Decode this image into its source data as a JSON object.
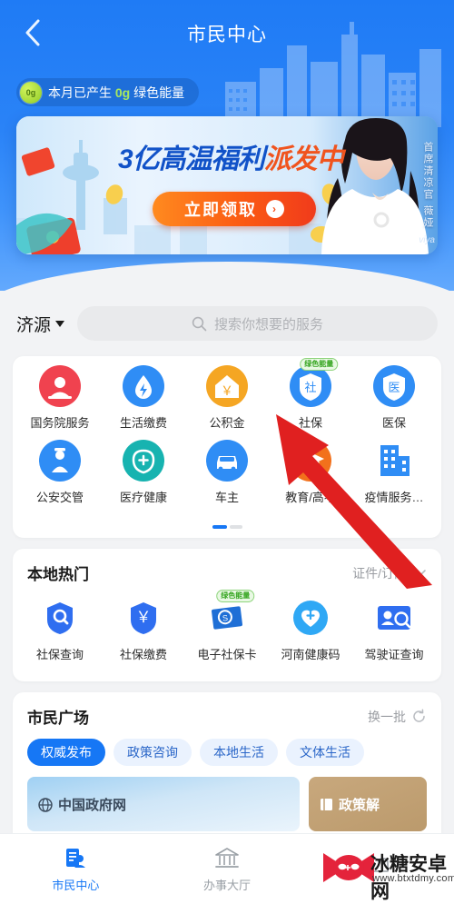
{
  "header": {
    "back_icon": "chevron-left-icon",
    "title": "市民中心",
    "energy": {
      "ball_text": "0g",
      "prefix": "本月已产生 ",
      "amount": "0g",
      "suffix": " 绿色能量"
    }
  },
  "banner": {
    "title_main": "3亿高温福利",
    "title_accent": "派发中",
    "cta_label": "立即领取",
    "cta_arrow": "arrow-right-icon",
    "vertical_text": "首席清凉官 薇娅",
    "vertical_sub": "viya"
  },
  "search": {
    "city": "济源",
    "city_caret": "caret-down-icon",
    "icon": "search-icon",
    "placeholder": "搜索你想要的服务"
  },
  "services": {
    "row1": [
      {
        "label": "国务院服务",
        "icon": "gov-council-icon",
        "color": "#f0424f",
        "glyph": "person",
        "badge": ""
      },
      {
        "label": "生活缴费",
        "icon": "water-drop-icon",
        "color": "#2f8df5",
        "glyph": "drop",
        "badge": ""
      },
      {
        "label": "公积金",
        "icon": "housing-fund-icon",
        "color": "#f5a623",
        "glyph": "house",
        "badge": ""
      },
      {
        "label": "社保",
        "icon": "social-security-icon",
        "color": "#2f8df5",
        "glyph": "shield-she",
        "badge": "绿色能量"
      },
      {
        "label": "医保",
        "icon": "medical-insurance-icon",
        "color": "#2f8df5",
        "glyph": "shield-yi",
        "badge": ""
      }
    ],
    "row2": [
      {
        "label": "公安交管",
        "icon": "police-traffic-icon",
        "color": "#2f8df5",
        "glyph": "officer",
        "badge": ""
      },
      {
        "label": "医疗健康",
        "icon": "health-care-icon",
        "color": "#17b3b0",
        "glyph": "stethoscope",
        "badge": ""
      },
      {
        "label": "车主",
        "icon": "car-owner-icon",
        "color": "#2f8df5",
        "glyph": "car",
        "badge": ""
      },
      {
        "label": "教育/高考",
        "icon": "education-icon",
        "color": "#f2711c",
        "glyph": "cap",
        "badge": ""
      },
      {
        "label": "疫情服务…",
        "icon": "epidemic-service-icon",
        "color": "#2f8df5",
        "glyph": "building",
        "badge": ""
      }
    ],
    "page_count": 2,
    "page_active": 0
  },
  "local_hot": {
    "title": "本地热门",
    "action_label": "证件/订阅",
    "action_icon": "chevron-down-icon",
    "items": [
      {
        "label": "社保查询",
        "icon": "shield-search-icon",
        "color": "#2f6ef0",
        "glyph": "shield-search",
        "badge": ""
      },
      {
        "label": "社保缴费",
        "icon": "shield-yuan-icon",
        "color": "#2f6ef0",
        "glyph": "shield-yuan",
        "badge": ""
      },
      {
        "label": "电子社保卡",
        "icon": "e-card-icon",
        "color": "#1f6fd6",
        "glyph": "ecard",
        "badge": "绿色能量"
      },
      {
        "label": "河南健康码",
        "icon": "health-code-icon",
        "color": "#2fa8f5",
        "glyph": "heart-plus",
        "badge": ""
      },
      {
        "label": "驾驶证查询",
        "icon": "license-search-icon",
        "color": "#2f6ef0",
        "glyph": "id-search",
        "badge": ""
      }
    ]
  },
  "plaza": {
    "title": "市民广场",
    "action_label": "换一批",
    "action_icon": "refresh-icon",
    "tabs": [
      {
        "label": "权威发布",
        "active": true
      },
      {
        "label": "政策咨询",
        "active": false
      },
      {
        "label": "本地生活",
        "active": false
      },
      {
        "label": "文体生活",
        "active": false
      }
    ],
    "cards": [
      {
        "label": "中国政府网",
        "icon": "globe-icon"
      },
      {
        "label": "政策解",
        "icon": "book-icon"
      }
    ]
  },
  "bottom_nav": [
    {
      "label": "市民中心",
      "icon": "citizen-center-icon",
      "active": true
    },
    {
      "label": "办事大厅",
      "icon": "service-hall-icon",
      "active": false
    },
    {
      "label": "",
      "icon": "profile-icon",
      "active": false
    }
  ],
  "watermark": {
    "name": "冰糖安卓网",
    "url": "www.btxtdmy.com",
    "icon": "candy-logo-icon"
  },
  "annotation": {
    "arrow_icon": "red-arrow-pointer",
    "color": "#e02020"
  }
}
